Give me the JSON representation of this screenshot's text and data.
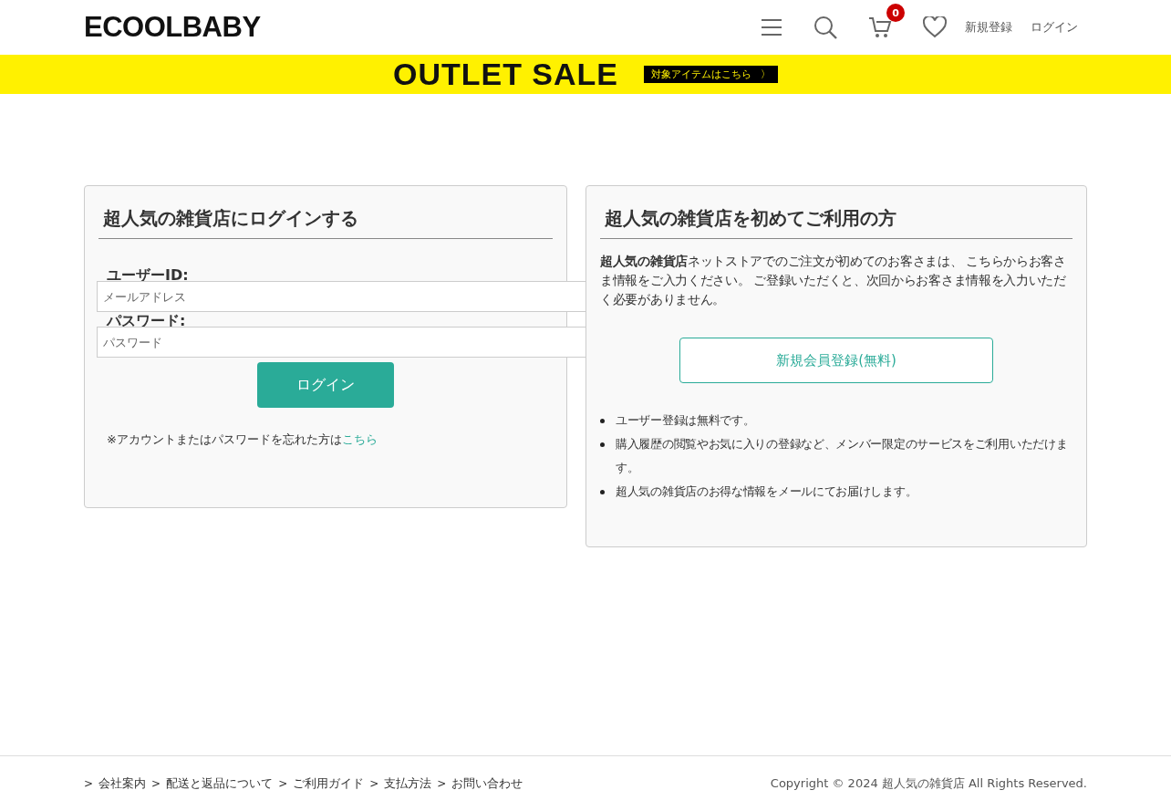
{
  "header": {
    "logo": "ECOOLBABY",
    "cart_count": "0",
    "links": [
      "新規登録",
      "ログイン"
    ]
  },
  "banner": {
    "title": "OUTLET SALE",
    "cta": "対象アイテムはこちら",
    "cta_arrow": "〉"
  },
  "login": {
    "title": "超人気の雑貨店にログインする",
    "user_label": "ユーザーID:",
    "user_placeholder": "メールアドレス",
    "password_label": "パスワード:",
    "password_placeholder": "パスワード",
    "button": "ログイン",
    "forgot_text": "※アカウントまたはパスワードを忘れた方は",
    "forgot_link": "こちら"
  },
  "register": {
    "title": "超人気の雑貨店を初めてご利用の方",
    "description": "**超人気の雑貨店**ネットストアでのご注文が初めてのお客さまは、 こちらからお客さま情報をご入力ください。 ご登録いただくと、次回からお客さま情報を入力いただく必要がありません。",
    "button": "新規会員登録(無料)",
    "benefits": [
      "ユーザー登録は無料です。",
      "購入履歴の閲覧やお気に入りの登録など、メンバー限定のサービスをご利用いただけます。",
      "超人気の雑貨店のお得な情報をメールにてお届けします。"
    ]
  },
  "footer": {
    "links": [
      {
        "marker": ">",
        "label": "会社案内"
      },
      {
        "marker": ">",
        "label": "配送と返品について"
      },
      {
        "marker": ">",
        "label": "ご利用ガイド"
      },
      {
        "marker": ">",
        "label": "支払方法"
      },
      {
        "marker": ">",
        "label": "お問い合わせ"
      }
    ],
    "copyright": "Copyright © 2024 超人気の雑貨店 All Rights Reserved."
  }
}
